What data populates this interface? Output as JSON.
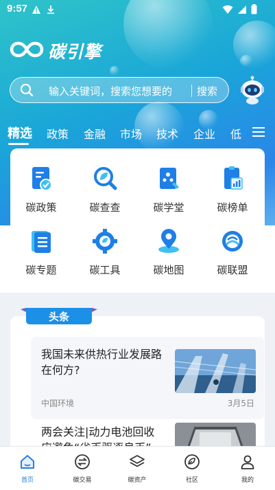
{
  "status_bar": {
    "time": "9:57"
  },
  "brand": {
    "name": "碳引擎"
  },
  "search": {
    "placeholder": "输入关键词，搜索您想要的",
    "button_label": "搜索"
  },
  "tabs": [
    {
      "label": "精选",
      "active": true
    },
    {
      "label": "政策"
    },
    {
      "label": "金融"
    },
    {
      "label": "市场"
    },
    {
      "label": "技术"
    },
    {
      "label": "企业"
    },
    {
      "label": "低"
    }
  ],
  "grid_items": [
    {
      "label": "碳政策",
      "icon": "policy-doc-icon"
    },
    {
      "label": "碳查查",
      "icon": "leaf-search-icon"
    },
    {
      "label": "碳学堂",
      "icon": "classroom-book-icon"
    },
    {
      "label": "碳榜单",
      "icon": "ranking-chart-icon"
    },
    {
      "label": "碳专题",
      "icon": "topic-list-icon"
    },
    {
      "label": "碳工具",
      "icon": "tool-gear-icon"
    },
    {
      "label": "碳地图",
      "icon": "map-pin-icon"
    },
    {
      "label": "碳联盟",
      "icon": "alliance-globe-icon"
    }
  ],
  "headline": {
    "label": "头条"
  },
  "news": [
    {
      "title": "我国未来供热行业发展路在何方?",
      "source": "中国环境",
      "date": "3月5日"
    },
    {
      "title": "两会关注|动力电池回收应避免“劣币驱逐良币”"
    }
  ],
  "bottom_nav": [
    {
      "label": "首页",
      "active": true
    },
    {
      "label": "碳交易"
    },
    {
      "label": "碳资产"
    },
    {
      "label": "社区"
    },
    {
      "label": "我的"
    }
  ],
  "colors": {
    "accent": "#2a7de1",
    "hero_start": "#2fc4c9",
    "hero_end": "#2a86e8",
    "tag": "#1c8fe6"
  }
}
